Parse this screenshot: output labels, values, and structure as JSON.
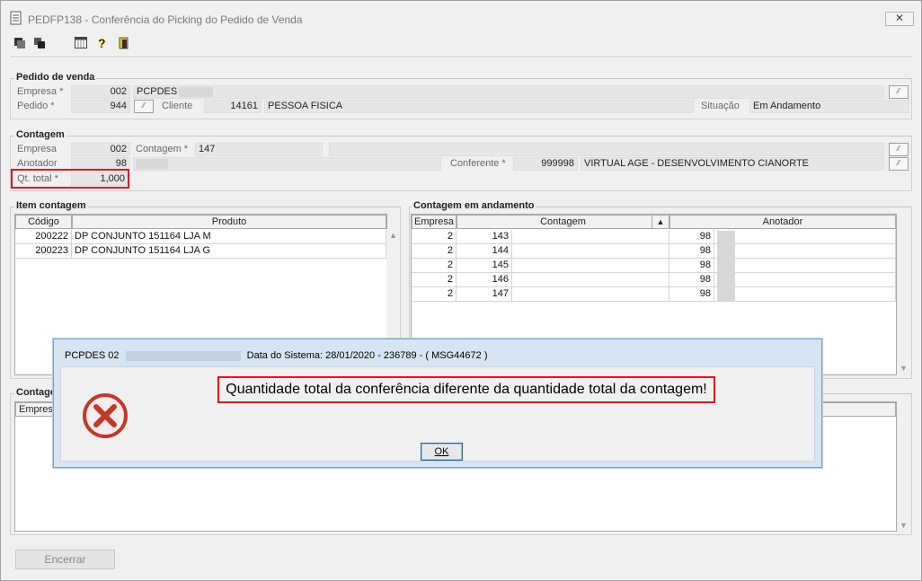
{
  "window": {
    "title": "PEDFP138 - Conferência do Picking do Pedido de Venda",
    "close_glyph": "✕"
  },
  "toolbar": {
    "icons": [
      "import-icon",
      "copy-icon",
      "calendar-icon",
      "help-icon",
      "exit-icon"
    ]
  },
  "pedido": {
    "legend": "Pedido de venda",
    "empresa_label": "Empresa *",
    "empresa_value": "002",
    "empresa_name": "PCPDES",
    "pedido_label": "Pedido *",
    "pedido_value": "944",
    "cliente_label": "Cliente",
    "cliente_code": "14161",
    "cliente_name": "PESSOA FISICA",
    "situacao_label": "Situação",
    "situacao_value": "Em Andamento"
  },
  "contagem": {
    "legend": "Contagem",
    "empresa_label": "Empresa",
    "empresa_value": "002",
    "contagem_label": "Contagem *",
    "contagem_value": "147",
    "anotador_label": "Anotador",
    "anotador_value": "98",
    "conferente_label": "Conferente *",
    "conferente_code": "999998",
    "conferente_name": "VIRTUAL AGE - DESENVOLVIMENTO CIANORTE",
    "qt_total_label": "Qt. total *",
    "qt_total_value": "1,000"
  },
  "item_contagem": {
    "legend": "Item contagem",
    "headers": [
      "Código",
      "Produto"
    ],
    "rows": [
      [
        "200222",
        "DP CONJUNTO 151164 LJA M"
      ],
      [
        "200223",
        "DP CONJUNTO 151164 LJA G"
      ]
    ]
  },
  "contagem_andamento": {
    "legend": "Contagem em andamento",
    "headers": [
      "Empresa",
      "Contagem",
      "Anotador"
    ],
    "rows": [
      [
        "2",
        "143",
        "98"
      ],
      [
        "2",
        "144",
        "98"
      ],
      [
        "2",
        "145",
        "98"
      ],
      [
        "2",
        "146",
        "98"
      ],
      [
        "2",
        "147",
        "98"
      ]
    ]
  },
  "bottom_section": {
    "legend": "Contage",
    "header_partial": "Empresa"
  },
  "footer": {
    "encerrar_label": "Encerrar"
  },
  "modal": {
    "title_prefix": "PCPDES 02",
    "title_suffix": "Data do Sistema: 28/01/2020 - 236789 - ( MSG44672 )",
    "message": "Quantidade total da conferência diferente da quantidade total da contagem!",
    "ok_label": "OK"
  },
  "colors": {
    "highlight": "#e0141b",
    "error_icon": "#c0392b",
    "modal_border": "#7b9fc3"
  }
}
